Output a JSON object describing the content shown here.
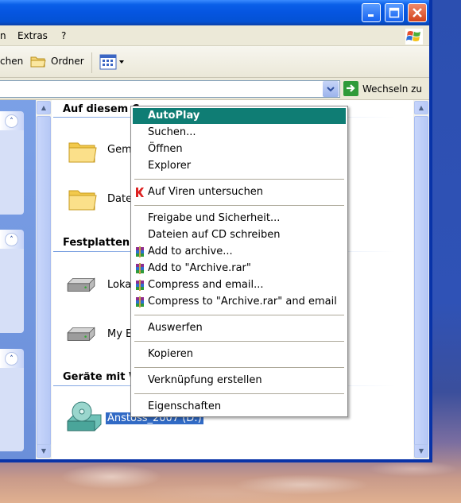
{
  "window": {
    "titlebar_buttons": [
      "minimize",
      "maximize",
      "close"
    ]
  },
  "menubar": {
    "items": [
      "n",
      "Extras",
      "?"
    ]
  },
  "toolbar": {
    "search_label": "chen",
    "folders_label": "Ordner"
  },
  "addressbar": {
    "go_label": "Wechseln zu"
  },
  "content": {
    "groups": [
      {
        "title": "Auf diesem C",
        "items": [
          {
            "label": "Gem"
          },
          {
            "label": "Date"
          }
        ]
      },
      {
        "title": "Festplatten",
        "items": [
          {
            "label": "Loka"
          },
          {
            "label": "My E"
          }
        ]
      },
      {
        "title": "Geräte mit W",
        "items": [
          {
            "label": "Anstoss_2007 (D:)"
          }
        ]
      }
    ]
  },
  "context_menu": {
    "items": [
      {
        "label": "AutoPlay",
        "highlighted": true
      },
      {
        "label": "Suchen..."
      },
      {
        "label": "Öffnen"
      },
      {
        "label": "Explorer"
      },
      {
        "label": "Auf Viren untersuchen",
        "icon": "kaspersky-icon"
      },
      {
        "label": "Freigabe und Sicherheit..."
      },
      {
        "label": "Dateien auf CD schreiben"
      },
      {
        "label": "Add to archive...",
        "icon": "winrar-icon"
      },
      {
        "label": "Add to \"Archive.rar\"",
        "icon": "winrar-icon"
      },
      {
        "label": "Compress and email...",
        "icon": "winrar-icon"
      },
      {
        "label": "Compress to \"Archive.rar\" and email",
        "icon": "winrar-icon"
      },
      {
        "label": "Auswerfen"
      },
      {
        "label": "Kopieren"
      },
      {
        "label": "Verknüpfung erstellen"
      },
      {
        "label": "Eigenschaften"
      }
    ]
  },
  "colors": {
    "titlebar_blue": "#0555e0",
    "menu_highlight": "#0f7d74",
    "selection_blue": "#316ac5"
  }
}
